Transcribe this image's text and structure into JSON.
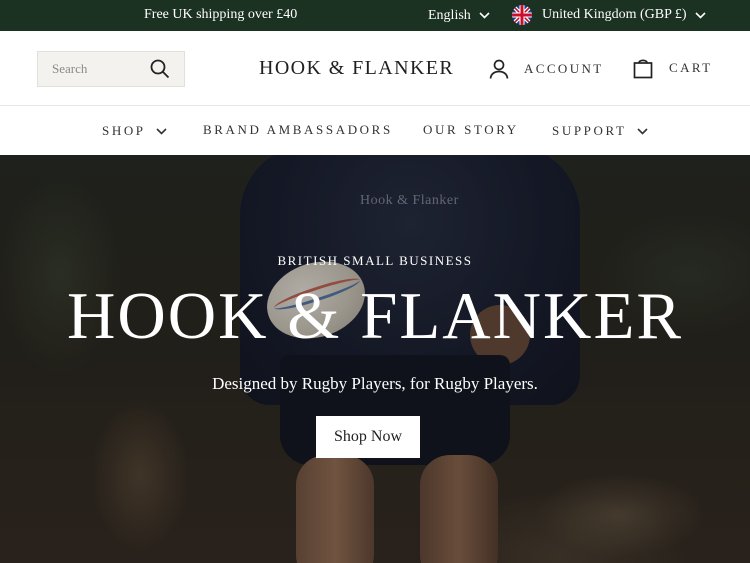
{
  "announcement": {
    "shipping_text": "Free UK shipping over £40",
    "language": "English",
    "country": "United Kingdom (GBP £)"
  },
  "header": {
    "search_placeholder": "Search",
    "logo": "HOOK & FLANKER",
    "account_label": "ACCOUNT",
    "cart_label": "CART"
  },
  "nav": {
    "items": [
      {
        "label": "SHOP",
        "has_dropdown": true
      },
      {
        "label": "BRAND AMBASSADORS",
        "has_dropdown": false
      },
      {
        "label": "OUR STORY",
        "has_dropdown": false
      },
      {
        "label": "SUPPORT",
        "has_dropdown": true
      }
    ]
  },
  "hero": {
    "kicker": "BRITISH SMALL BUSINESS",
    "title": "HOOK & FLANKER",
    "tagline": "Designed by Rugby Players, for Rugby Players.",
    "cta_label": "Shop Now",
    "shirt_print": "Hook & Flanker"
  },
  "colors": {
    "announcement_bg": "#1b3122",
    "text_dark": "#1f1f1f",
    "search_bg": "#f3f2ef"
  },
  "icons": [
    "chevron-down-icon",
    "uk-flag-icon",
    "search-icon",
    "user-icon",
    "bag-icon"
  ]
}
